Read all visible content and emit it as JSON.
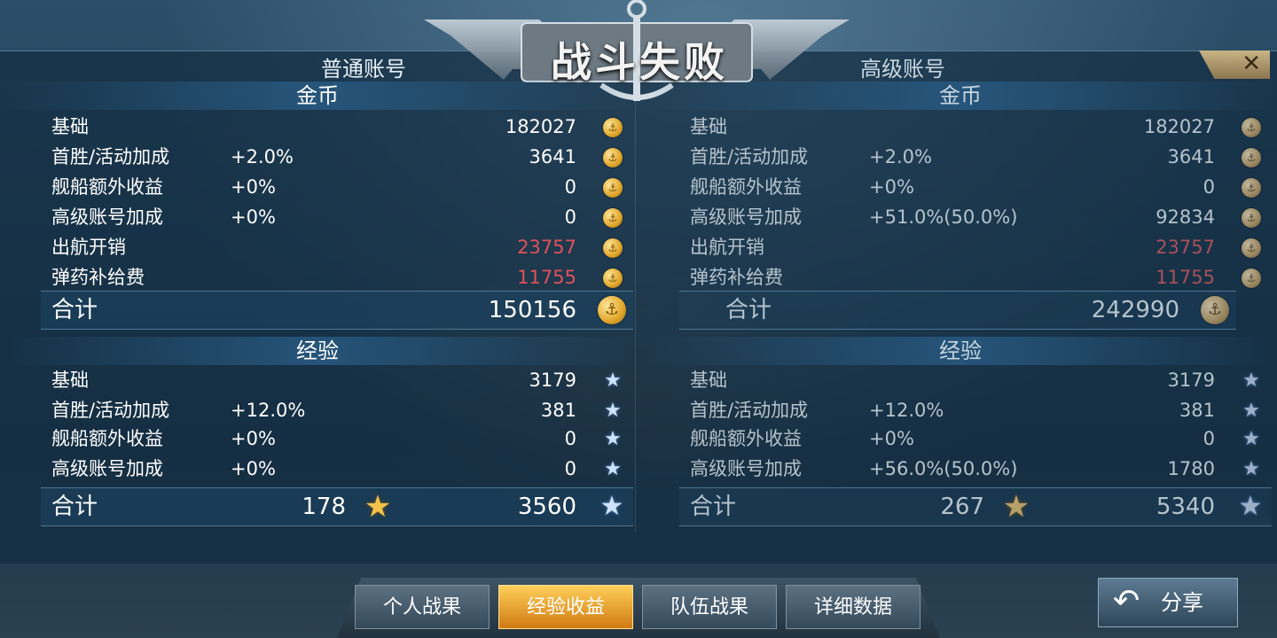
{
  "title": "战斗失败",
  "close_glyph": "✕",
  "left": {
    "header": "普通账号",
    "gold": {
      "section": "金币",
      "rows": [
        {
          "label": "基础",
          "pct": "",
          "value": "182027"
        },
        {
          "label": "首胜/活动加成",
          "pct": "+2.0%",
          "value": "3641"
        },
        {
          "label": "舰船额外收益",
          "pct": "+0%",
          "value": "0"
        },
        {
          "label": "高级账号加成",
          "pct": "+0%",
          "value": "0"
        },
        {
          "label": "出航开销",
          "pct": "",
          "value": "23757"
        },
        {
          "label": "弹药补给费",
          "pct": "",
          "value": "11755"
        }
      ],
      "total_label": "合计",
      "total_value": "150156"
    },
    "exp": {
      "section": "经验",
      "rows": [
        {
          "label": "基础",
          "pct": "",
          "value": "3179"
        },
        {
          "label": "首胜/活动加成",
          "pct": "+12.0%",
          "value": "381"
        },
        {
          "label": "舰船额外收益",
          "pct": "+0%",
          "value": "0"
        },
        {
          "label": "高级账号加成",
          "pct": "+0%",
          "value": "0"
        }
      ],
      "total_label": "合计",
      "total_mid": "178",
      "total_value": "3560"
    }
  },
  "right": {
    "header": "高级账号",
    "gold": {
      "section": "金币",
      "rows": [
        {
          "label": "基础",
          "pct": "",
          "value": "182027"
        },
        {
          "label": "首胜/活动加成",
          "pct": "+2.0%",
          "value": "3641"
        },
        {
          "label": "舰船额外收益",
          "pct": "+0%",
          "value": "0"
        },
        {
          "label": "高级账号加成",
          "pct": "+51.0%(50.0%)",
          "value": "92834"
        },
        {
          "label": "出航开销",
          "pct": "",
          "value": "23757"
        },
        {
          "label": "弹药补给费",
          "pct": "",
          "value": "11755"
        }
      ],
      "total_label": "合计",
      "total_value": "242990"
    },
    "exp": {
      "section": "经验",
      "rows": [
        {
          "label": "基础",
          "pct": "",
          "value": "3179"
        },
        {
          "label": "首胜/活动加成",
          "pct": "+12.0%",
          "value": "381"
        },
        {
          "label": "舰船额外收益",
          "pct": "+0%",
          "value": "0"
        },
        {
          "label": "高级账号加成",
          "pct": "+56.0%(50.0%)",
          "value": "1780"
        }
      ],
      "total_label": "合计",
      "total_mid": "267",
      "total_value": "5340"
    }
  },
  "tabs": [
    {
      "label": "个人战果",
      "active": false
    },
    {
      "label": "经验收益",
      "active": true
    },
    {
      "label": "队伍战果",
      "active": false
    },
    {
      "label": "详细数据",
      "active": false
    }
  ],
  "share": {
    "label": "分享",
    "icon": "return-arrow-icon"
  },
  "icons": {
    "coin": "anchor-coin-icon",
    "exp": "star-icon",
    "captain_exp": "gold-star-icon"
  },
  "colors": {
    "expense": "#e0515a",
    "active_tab": "#f0a22a",
    "coin": "#e0a52a"
  }
}
